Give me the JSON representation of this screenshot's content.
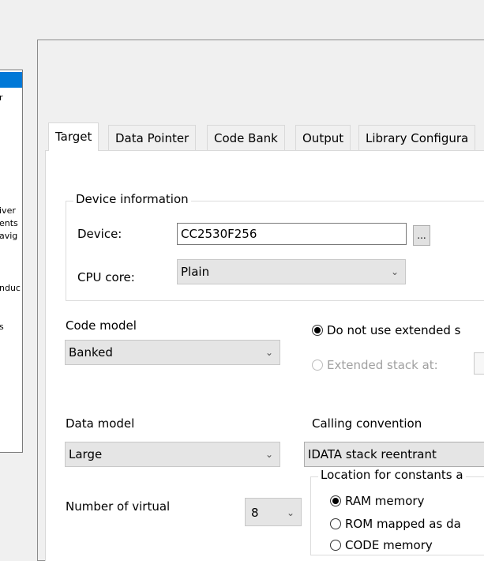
{
  "left_list": {
    "fragments": [
      "r",
      "iver",
      "ents",
      "avig",
      "nduc",
      "s"
    ]
  },
  "tabs": [
    {
      "label": "Target"
    },
    {
      "label": "Data Pointer"
    },
    {
      "label": "Code Bank"
    },
    {
      "label": "Output"
    },
    {
      "label": "Library Configura"
    }
  ],
  "device_info": {
    "legend": "Device information",
    "device_label": "Device:",
    "device_value": "CC2530F256",
    "browse_label": "...",
    "cpu_label": "CPU core:",
    "cpu_value": "Plain"
  },
  "code_model": {
    "label": "Code model",
    "value": "Banked"
  },
  "data_model": {
    "label": "Data model",
    "value": "Large"
  },
  "stack": {
    "no_extended": "Do not use extended s",
    "extended_at": "Extended stack at:"
  },
  "calling_convention": {
    "label": "Calling convention",
    "value": "IDATA stack reentrant"
  },
  "virtual_regs": {
    "label": "Number of virtual",
    "value": "8"
  },
  "constants": {
    "legend": "Location for constants a",
    "options": [
      "RAM memory",
      "ROM mapped as da",
      "CODE memory"
    ]
  },
  "icons": {
    "dropdown": "chevron-down-icon"
  }
}
